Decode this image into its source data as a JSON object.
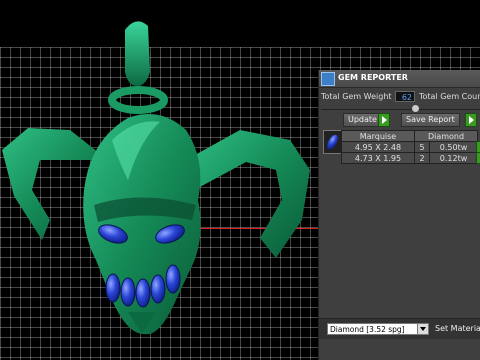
{
  "panel": {
    "title": "GEM REPORTER",
    "total_weight_label": "Total Gem Weight",
    "total_weight_value": "62",
    "total_count_label": "Total Gem Count",
    "update_label": "Update",
    "save_report_label": "Save Report",
    "gem_table": {
      "headers": [
        "Marquise",
        "Diamond"
      ],
      "rows": [
        {
          "size": "4.95 X 2.48",
          "count": "5",
          "weight": "0.50tw"
        },
        {
          "size": "4.73 X 1.95",
          "count": "2",
          "weight": "0.12tw"
        }
      ]
    },
    "material_select_value": "Diamond   [3.52 spg]",
    "set_material_label": "Set Material"
  },
  "colors": {
    "model_green": "#1a8a5a",
    "gem_blue": "#2b45d6",
    "panel_bg": "#3f3f3f",
    "accent_green": "#3a9a24"
  }
}
